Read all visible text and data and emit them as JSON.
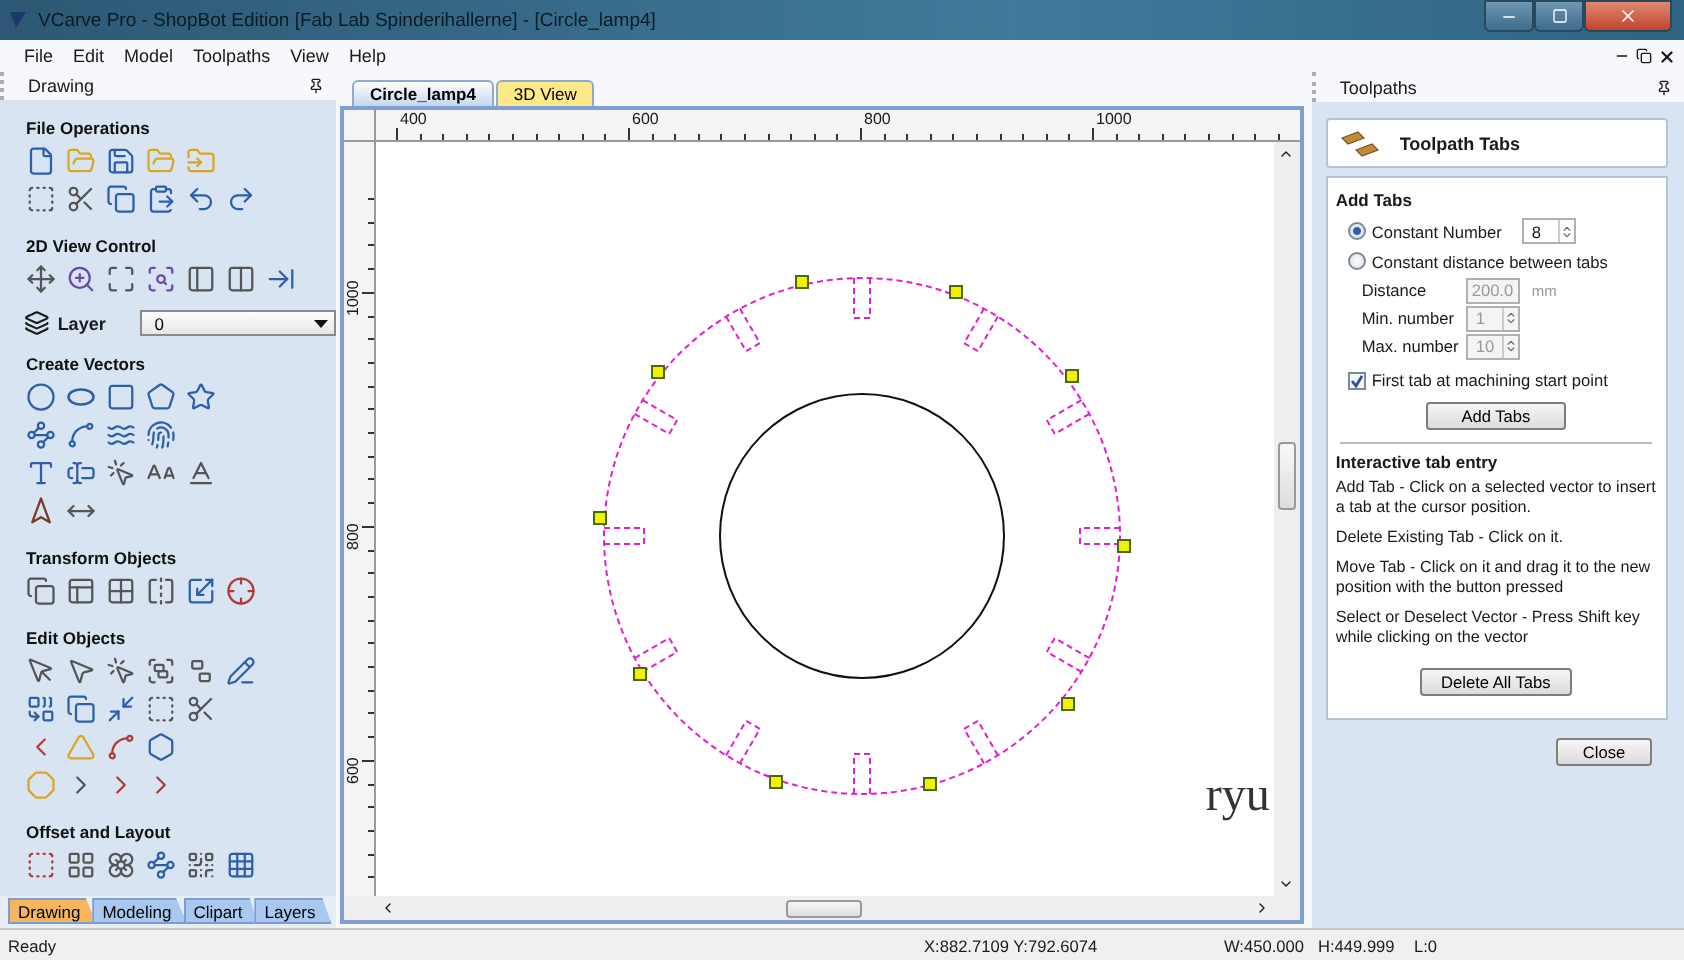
{
  "window": {
    "title": "VCarve Pro - ShopBot Edition [Fab Lab Spinderihallerne] - [Circle_lamp4]"
  },
  "menu": [
    "File",
    "Edit",
    "Model",
    "Toolpaths",
    "View",
    "Help"
  ],
  "drawing_panel": {
    "title": "Drawing",
    "sections": [
      {
        "kind": "tools",
        "title": "File Operations"
      },
      {
        "kind": "tools",
        "title": "2D View Control"
      },
      {
        "kind": "layer",
        "label": "Layer",
        "value": "0"
      },
      {
        "kind": "tools",
        "title": "Create Vectors"
      },
      {
        "kind": "tools",
        "title": "Transform Objects"
      },
      {
        "kind": "tools",
        "title": "Edit Objects"
      },
      {
        "kind": "tools",
        "title": "Offset and Layout"
      }
    ],
    "tabs": [
      {
        "label": "Drawing",
        "selected": true
      },
      {
        "label": "Modeling",
        "selected": false
      },
      {
        "label": "Clipart",
        "selected": false
      },
      {
        "label": "Layers",
        "selected": false
      }
    ]
  },
  "document_tabs": [
    {
      "label": "Circle_lamp4",
      "selected": true
    },
    {
      "label": "3D View",
      "selected": false
    }
  ],
  "rulers": {
    "horizontal": [
      "400",
      "600",
      "800",
      "1000"
    ],
    "vertical": [
      "1000",
      "800",
      "600"
    ]
  },
  "canvas": {
    "text": "ryu"
  },
  "toolpaths_panel": {
    "title": "Toolpaths",
    "heading": "Toolpath Tabs",
    "add_tabs": {
      "title": "Add Tabs",
      "options": [
        {
          "label": "Constant Number",
          "selected": true,
          "value": "8"
        },
        {
          "label": "Constant distance between tabs",
          "selected": false
        }
      ],
      "fields": [
        {
          "label": "Distance",
          "value": "200.0",
          "unit": "mm",
          "disabled": true
        },
        {
          "label": "Min. number",
          "value": "1",
          "disabled": true
        },
        {
          "label": "Max. number",
          "value": "10",
          "disabled": true
        }
      ],
      "first_tab": {
        "label": "First tab at machining start point",
        "checked": true
      },
      "button": "Add Tabs"
    },
    "interactive": {
      "title": "Interactive tab entry",
      "paragraphs": [
        "Add Tab - Click on a selected vector to insert a tab at the cursor position.",
        "Delete Existing Tab - Click on it.",
        "Move Tab - Click on it and drag it to the new position with the button pressed",
        "Select or Deselect Vector - Press Shift key while clicking on the vector"
      ],
      "button": "Delete All Tabs"
    },
    "close": "Close"
  },
  "status_bar": {
    "message": "Ready",
    "cursor": "X:882.7109 Y:792.6074",
    "width": "W:450.000",
    "height": "H:449.999",
    "layer": "L:0"
  }
}
